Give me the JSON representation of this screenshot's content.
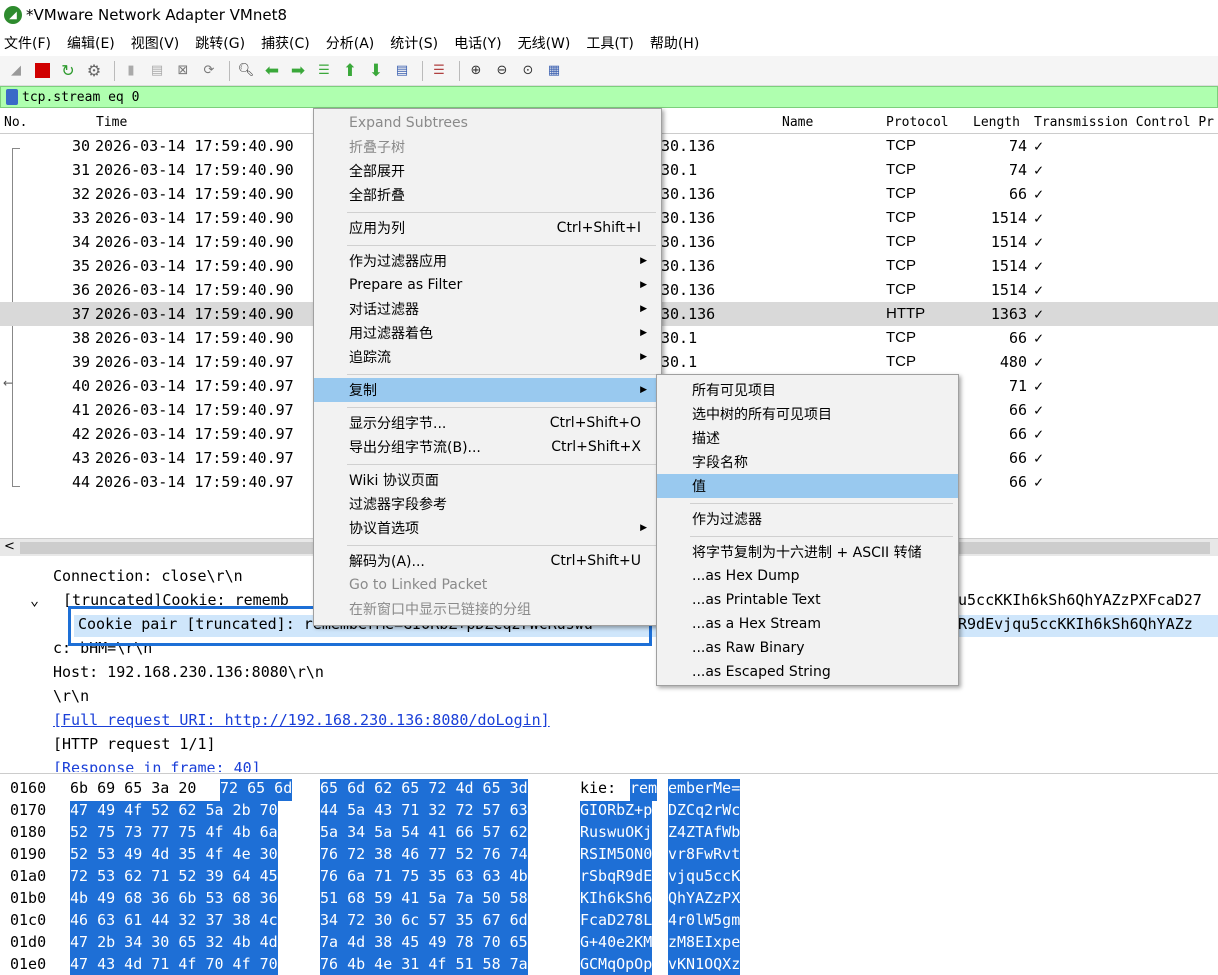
{
  "window": {
    "title": "*VMware Network Adapter VMnet8"
  },
  "menubar": [
    "文件(F)",
    "编辑(E)",
    "视图(V)",
    "跳转(G)",
    "捕获(C)",
    "分析(A)",
    "统计(S)",
    "电话(Y)",
    "无线(W)",
    "工具(T)",
    "帮助(H)"
  ],
  "filter": {
    "value": "tcp.stream eq 0"
  },
  "packet_list": {
    "columns": {
      "no": "No.",
      "time": "Time",
      "name": "Name",
      "protocol": "Protocol",
      "length": "Length",
      "extra": "Transmission Control Pr"
    },
    "rows": [
      {
        "no": "30",
        "time": "2026-03-14 17:59:40.90",
        "dst": "30.136",
        "proto": "TCP",
        "len": "74",
        "chk": "✓"
      },
      {
        "no": "31",
        "time": "2026-03-14 17:59:40.90",
        "dst": "30.1",
        "proto": "TCP",
        "len": "74",
        "chk": "✓"
      },
      {
        "no": "32",
        "time": "2026-03-14 17:59:40.90",
        "dst": "30.136",
        "proto": "TCP",
        "len": "66",
        "chk": "✓"
      },
      {
        "no": "33",
        "time": "2026-03-14 17:59:40.90",
        "dst": "30.136",
        "proto": "TCP",
        "len": "1514",
        "chk": "✓"
      },
      {
        "no": "34",
        "time": "2026-03-14 17:59:40.90",
        "dst": "30.136",
        "proto": "TCP",
        "len": "1514",
        "chk": "✓"
      },
      {
        "no": "35",
        "time": "2026-03-14 17:59:40.90",
        "dst": "30.136",
        "proto": "TCP",
        "len": "1514",
        "chk": "✓"
      },
      {
        "no": "36",
        "time": "2026-03-14 17:59:40.90",
        "dst": "30.136",
        "proto": "TCP",
        "len": "1514",
        "chk": "✓"
      },
      {
        "no": "37",
        "time": "2026-03-14 17:59:40.90",
        "dst": "30.136",
        "proto": "HTTP",
        "len": "1363",
        "chk": "✓"
      },
      {
        "no": "38",
        "time": "2026-03-14 17:59:40.90",
        "dst": "30.1",
        "proto": "TCP",
        "len": "66",
        "chk": "✓"
      },
      {
        "no": "39",
        "time": "2026-03-14 17:59:40.97",
        "dst": "30.1",
        "proto": "TCP",
        "len": "480",
        "chk": "✓"
      },
      {
        "no": "40",
        "time": "2026-03-14 17:59:40.97",
        "dst": "",
        "proto": "",
        "len": "71",
        "chk": "✓"
      },
      {
        "no": "41",
        "time": "2026-03-14 17:59:40.97",
        "dst": "",
        "proto": "",
        "len": "66",
        "chk": "✓"
      },
      {
        "no": "42",
        "time": "2026-03-14 17:59:40.97",
        "dst": "",
        "proto": "",
        "len": "66",
        "chk": "✓"
      },
      {
        "no": "43",
        "time": "2026-03-14 17:59:40.97",
        "dst": "",
        "proto": "",
        "len": "66",
        "chk": "✓"
      },
      {
        "no": "44",
        "time": "2026-03-14 17:59:40.97",
        "dst": "",
        "proto": "",
        "len": "66",
        "chk": "✓"
      }
    ]
  },
  "details": {
    "connection": "Connection: close\\r\\n",
    "cookie_left": "[truncated]Cookie: rememb",
    "cookie_right": "u5ccKKIh6kSh6QhYAZzPXFcaD27",
    "pair_left": "Cookie pair [truncated]: rememberMe=GIORbZ+pDZCq2rWcRuswu",
    "pair_right": "R9dEvjqu5ccKKIh6kSh6QhYAZz",
    "c_line": "c: bHM=\\r\\n",
    "host": "Host: 192.168.230.136:8080\\r\\n",
    "crlf": "\\r\\n",
    "full_uri": "[Full request URI: http://192.168.230.136:8080/doLogin]",
    "http_req": "[HTTP request 1/1]",
    "response_in": "[Response in frame: 40]"
  },
  "hex": [
    {
      "off": "0160",
      "pre": "6b 69 65 3a 20 ",
      "h1": "72 65 6d",
      "h2": "65 6d 62 65 72 4d 65 3d",
      "apre": "kie: ",
      "a1": "rem",
      "a2": "emberMe="
    },
    {
      "off": "0170",
      "pre": "",
      "h1": "47 49 4f 52 62 5a 2b 70",
      "h2": "44 5a 43 71 32 72 57 63",
      "apre": "",
      "a1": "GIORbZ+p",
      "a2": "DZCq2rWc"
    },
    {
      "off": "0180",
      "pre": "",
      "h1": "52 75 73 77 75 4f 4b 6a",
      "h2": "5a 34 5a 54 41 66 57 62",
      "apre": "",
      "a1": "RuswuOKj",
      "a2": "Z4ZTAfWb"
    },
    {
      "off": "0190",
      "pre": "",
      "h1": "52 53 49 4d 35 4f 4e 30",
      "h2": "76 72 38 46 77 52 76 74",
      "apre": "",
      "a1": "RSIM5ON0",
      "a2": "vr8FwRvt"
    },
    {
      "off": "01a0",
      "pre": "",
      "h1": "72 53 62 71 52 39 64 45",
      "h2": "76 6a 71 75 35 63 63 4b",
      "apre": "",
      "a1": "rSbqR9dE",
      "a2": "vjqu5ccK"
    },
    {
      "off": "01b0",
      "pre": "",
      "h1": "4b 49 68 36 6b 53 68 36",
      "h2": "51 68 59 41 5a 7a 50 58",
      "apre": "",
      "a1": "KIh6kSh6",
      "a2": "QhYAZzPX"
    },
    {
      "off": "01c0",
      "pre": "",
      "h1": "46 63 61 44 32 37 38 4c",
      "h2": "34 72 30 6c 57 35 67 6d",
      "apre": "",
      "a1": "FcaD278L",
      "a2": "4r0lW5gm"
    },
    {
      "off": "01d0",
      "pre": "",
      "h1": "47 2b 34 30 65 32 4b 4d",
      "h2": "7a 4d 38 45 49 78 70 65",
      "apre": "",
      "a1": "G+40e2KM",
      "a2": "zM8EIxpe"
    },
    {
      "off": "01e0",
      "pre": "",
      "h1": "47 43 4d 71 4f 70 4f 70",
      "h2": "76 4b 4e 31 4f 51 58 7a",
      "apre": "",
      "a1": "GCMqOpOp",
      "a2": "vKN1OQXz"
    }
  ],
  "context_menu": {
    "items": [
      {
        "label": "Expand Subtrees",
        "disabled": true
      },
      {
        "label": "折叠子树",
        "disabled": true
      },
      {
        "label": "全部展开"
      },
      {
        "label": "全部折叠"
      },
      {
        "sep": true
      },
      {
        "label": "应用为列",
        "shortcut": "Ctrl+Shift+I"
      },
      {
        "sep": true
      },
      {
        "label": "作为过滤器应用",
        "submenu": true
      },
      {
        "label": "Prepare as Filter",
        "submenu": true
      },
      {
        "label": "对话过滤器",
        "submenu": true
      },
      {
        "label": "用过滤器着色",
        "submenu": true
      },
      {
        "label": "追踪流",
        "submenu": true
      },
      {
        "sep": true
      },
      {
        "label": "复制",
        "submenu": true,
        "hover": true
      },
      {
        "sep": true
      },
      {
        "label": "显示分组字节...",
        "shortcut": "Ctrl+Shift+O"
      },
      {
        "label": "导出分组字节流(B)...",
        "shortcut": "Ctrl+Shift+X"
      },
      {
        "sep": true
      },
      {
        "label": "Wiki 协议页面"
      },
      {
        "label": "过滤器字段参考"
      },
      {
        "label": "协议首选项",
        "submenu": true
      },
      {
        "sep": true
      },
      {
        "label": "解码为(A)...",
        "shortcut": "Ctrl+Shift+U"
      },
      {
        "label": "Go to Linked Packet",
        "disabled": true
      },
      {
        "label": "在新窗口中显示已链接的分组",
        "disabled": true
      }
    ]
  },
  "copy_submenu": {
    "items": [
      {
        "label": "所有可见项目"
      },
      {
        "label": "选中树的所有可见项目"
      },
      {
        "label": "描述"
      },
      {
        "label": "字段名称"
      },
      {
        "label": "值",
        "hover": true
      },
      {
        "sep": true
      },
      {
        "label": "作为过滤器"
      },
      {
        "sep": true
      },
      {
        "label": "将字节复制为十六进制 + ASCII 转储"
      },
      {
        "label": "...as Hex Dump"
      },
      {
        "label": "...as Printable Text"
      },
      {
        "label": "...as a Hex Stream"
      },
      {
        "label": "...as Raw Binary"
      },
      {
        "label": "...as Escaped String"
      }
    ]
  },
  "colors": {
    "filter_bg": "#afffaf",
    "selection": "#1e6fd6",
    "menu_hover": "#99c9ef",
    "highlight_box": "#1d6fd6"
  }
}
